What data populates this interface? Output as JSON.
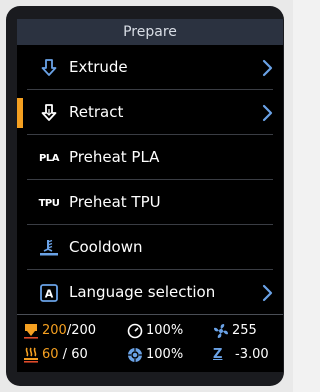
{
  "header": {
    "title": "Prepare"
  },
  "menu": [
    {
      "label": "Extrude",
      "icon": "extrude-icon",
      "has_submenu": true,
      "selected": false
    },
    {
      "label": "Retract",
      "icon": "retract-icon",
      "has_submenu": true,
      "selected": true
    },
    {
      "label": "Preheat PLA",
      "icon": "pla-icon",
      "icon_text": "PLA",
      "has_submenu": false,
      "selected": false
    },
    {
      "label": "Preheat TPU",
      "icon": "tpu-icon",
      "icon_text": "TPU",
      "has_submenu": false,
      "selected": false
    },
    {
      "label": "Cooldown",
      "icon": "cooldown-icon",
      "has_submenu": false,
      "selected": false
    },
    {
      "label": "Language selection",
      "icon": "language-icon",
      "icon_text": "A",
      "has_submenu": true,
      "selected": false
    }
  ],
  "status": {
    "hotend_current": "200",
    "hotend_target": "/200",
    "feedrate": "100%",
    "fan": "255",
    "bed_current": "60",
    "bed_target": " / 60",
    "flow": "100%",
    "z_label": "Z",
    "z_value": "-3.00"
  },
  "colors": {
    "accent": "#f5a021",
    "icon_blue": "#6aa2e6",
    "header_bg": "#2b3240",
    "screen_bg": "#000000"
  }
}
